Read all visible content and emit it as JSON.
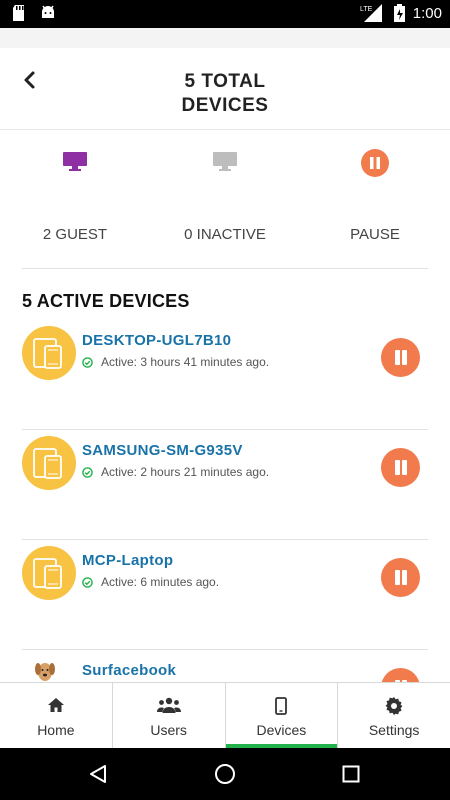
{
  "status_bar": {
    "network": "LTE",
    "time": "1:00"
  },
  "header": {
    "title_line1": "5 TOTAL",
    "title_line2": "DEVICES"
  },
  "summary": {
    "guest_label": "2 GUEST",
    "inactive_label": "0 INACTIVE",
    "pause_label": "PAUSE",
    "guest_color": "#8e2fa3",
    "inactive_color": "#bdbdbd",
    "pause_color": "#f17b4d"
  },
  "section": {
    "title": "5 ACTIVE DEVICES"
  },
  "devices": [
    {
      "name": "DESKTOP-UGL7B10",
      "status": "Active: 3 hours 41 minutes ago."
    },
    {
      "name": "SAMSUNG-SM-G935V",
      "status": "Active: 2 hours 21 minutes ago."
    },
    {
      "name": "MCP-Laptop",
      "status": "Active: 6 minutes ago."
    },
    {
      "name": "Surfacebook",
      "status": ""
    }
  ],
  "tabs": [
    {
      "label": "Home",
      "icon": "home-icon"
    },
    {
      "label": "Users",
      "icon": "users-icon"
    },
    {
      "label": "Devices",
      "icon": "devices-icon",
      "active": true
    },
    {
      "label": "Settings",
      "icon": "gear-icon"
    }
  ],
  "colors": {
    "accent_green": "#22b24c",
    "device_name_blue": "#1a73a8",
    "avatar_yellow": "#f8c243"
  }
}
